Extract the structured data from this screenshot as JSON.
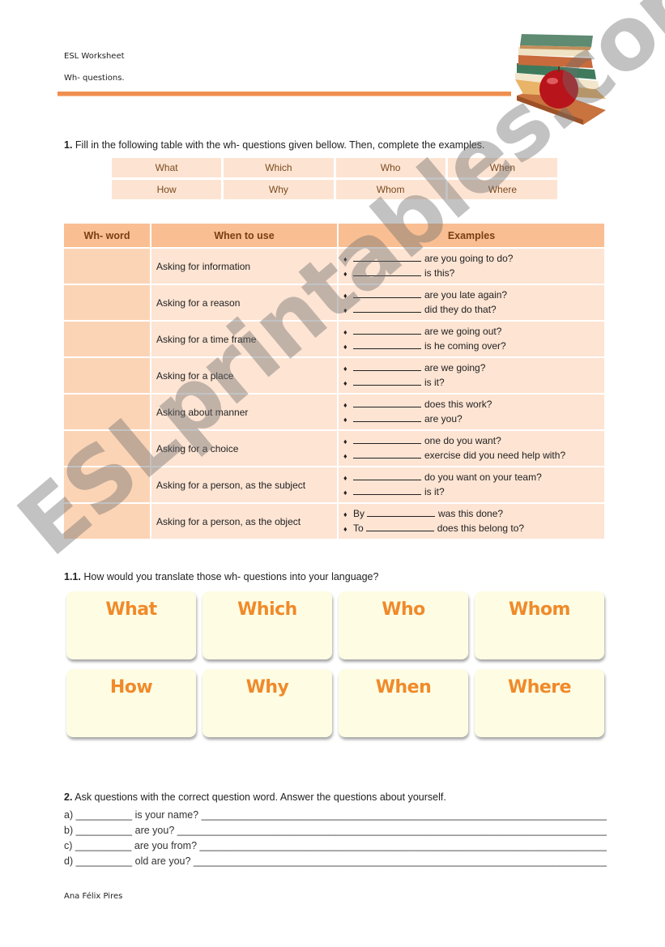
{
  "header": {
    "line1": "ESL Worksheet",
    "line2": "Wh- questions.",
    "image": "books-with-apple-image"
  },
  "colors": {
    "accent_line": "#ef8f4f",
    "table_header": "#f9bf93",
    "table_cell": "#fde4d3",
    "card_bg": "#fefde4",
    "card_text": "#f08a2a"
  },
  "section1": {
    "number": "1.",
    "instruction": "Fill in the following table with the wh- questions given bellow. Then, complete the examples.",
    "word_bank": [
      "What",
      "Which",
      "Who",
      "When",
      "How",
      "Why",
      "Whom",
      "Where"
    ],
    "table": {
      "headers": [
        "Wh- word",
        "When to use",
        "Examples"
      ],
      "rows": [
        {
          "use": "Asking for information",
          "examples": [
            {
              "prefix": "",
              "suffix": "are you going to do?"
            },
            {
              "prefix": "",
              "suffix": "is this?"
            }
          ]
        },
        {
          "use": "Asking for a reason",
          "examples": [
            {
              "prefix": "",
              "suffix": "are you late again?"
            },
            {
              "prefix": "",
              "suffix": "did they do that?"
            }
          ]
        },
        {
          "use": "Asking for a time frame",
          "examples": [
            {
              "prefix": "",
              "suffix": "are we going out?"
            },
            {
              "prefix": "",
              "suffix": "is he coming over?"
            }
          ]
        },
        {
          "use": "Asking for a place",
          "examples": [
            {
              "prefix": "",
              "suffix": "are we going?"
            },
            {
              "prefix": "",
              "suffix": "is it?"
            }
          ]
        },
        {
          "use": "Asking about manner",
          "examples": [
            {
              "prefix": "",
              "suffix": "does this work?"
            },
            {
              "prefix": "",
              "suffix": "are you?"
            }
          ]
        },
        {
          "use": "Asking for a choice",
          "examples": [
            {
              "prefix": "",
              "suffix": "one do you want?"
            },
            {
              "prefix": "",
              "suffix": "exercise did you need help with?"
            }
          ]
        },
        {
          "use": "Asking for a person, as the subject",
          "examples": [
            {
              "prefix": "",
              "suffix": "do you want on your team?"
            },
            {
              "prefix": "",
              "suffix": "is it?"
            }
          ]
        },
        {
          "use": "Asking for a person, as the object",
          "examples": [
            {
              "prefix": "By",
              "suffix": "was this done?"
            },
            {
              "prefix": "To",
              "suffix": "does this belong to?"
            }
          ]
        }
      ]
    }
  },
  "section1_1": {
    "number": "1.1.",
    "instruction": "How would you translate those wh- questions into your language?",
    "cards": [
      "What",
      "Which",
      "Who",
      "Whom",
      "How",
      "Why",
      "When",
      "Where"
    ]
  },
  "section2": {
    "number": "2.",
    "instruction": "Ask questions with the correct question word. Answer the questions about yourself.",
    "items": [
      {
        "label": "a)",
        "question": "is your name?"
      },
      {
        "label": "b)",
        "question": "are you?"
      },
      {
        "label": "c)",
        "question": "are you from?"
      },
      {
        "label": "d)",
        "question": "old are you?"
      }
    ]
  },
  "footer": {
    "author": "Ana Félix Pires"
  },
  "watermark": "ESLprintables.com"
}
